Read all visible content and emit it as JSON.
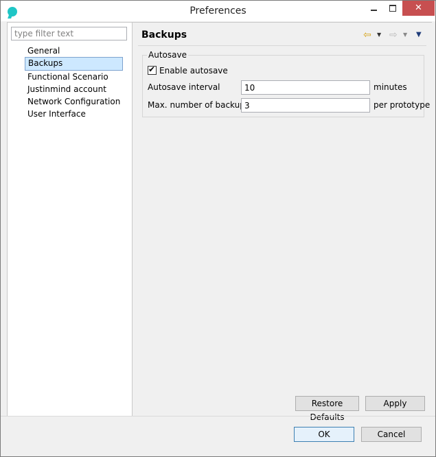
{
  "window": {
    "title": "Preferences"
  },
  "sidebar": {
    "filter_placeholder": "type filter text",
    "items": [
      {
        "label": "General",
        "selected": false
      },
      {
        "label": "Backups",
        "selected": true
      },
      {
        "label": "Functional Scenario",
        "selected": false
      },
      {
        "label": "Justinmind account",
        "selected": false
      },
      {
        "label": "Network Configuration",
        "selected": false
      },
      {
        "label": "User Interface",
        "selected": false
      }
    ]
  },
  "page": {
    "title": "Backups",
    "autosave": {
      "legend": "Autosave",
      "enable_label": "Enable autosave",
      "enabled": true,
      "interval": {
        "label": "Autosave interval",
        "value": "10",
        "unit": "minutes"
      },
      "max_backups": {
        "label": "Max. number of backups",
        "value": "3",
        "unit": "per prototype"
      }
    },
    "buttons": {
      "restore": "Restore Defaults",
      "apply": "Apply"
    }
  },
  "dialog": {
    "ok": "OK",
    "cancel": "Cancel"
  },
  "colors": {
    "accent": "#1fc6c6",
    "selection": "#cde8ff",
    "close": "#c74f50"
  }
}
